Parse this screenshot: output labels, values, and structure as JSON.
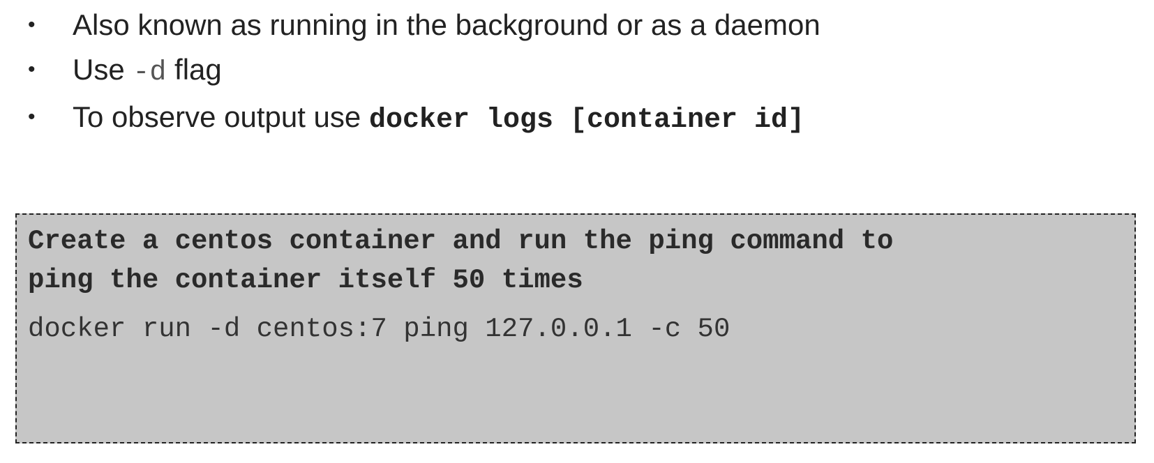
{
  "bullets": [
    {
      "text": "Also known as running in the background or as a daemon"
    },
    {
      "prefix": "Use ",
      "code": "-d",
      "suffix": " flag"
    },
    {
      "prefix": "To observe output use ",
      "code": "docker logs [container id]"
    }
  ],
  "bullet_symbol": "•",
  "task": {
    "heading_line1": "Create a centos container and run the ping command to",
    "heading_line2": "ping the container itself 50 times",
    "command": "docker run -d centos:7 ping 127.0.0.1 -c 50"
  },
  "colors": {
    "box_background": "#c6c6c6",
    "box_border": "#222222",
    "text": "#222222"
  }
}
